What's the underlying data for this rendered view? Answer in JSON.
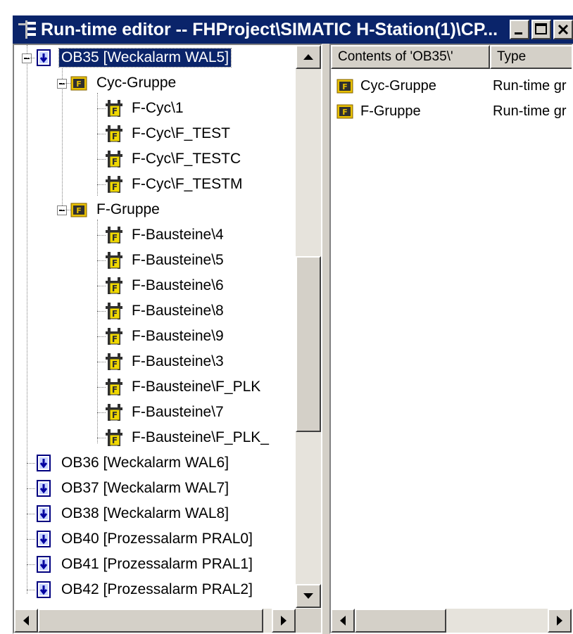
{
  "window": {
    "title": "Run-time editor -- FHProject\\SIMATIC H-Station(1)\\CP...",
    "controls": [
      "minimize",
      "maximize",
      "close"
    ]
  },
  "tree": {
    "nodes": [
      {
        "label": "OB35  [Weckalarm WAL5]",
        "type": "ob",
        "selected": true
      },
      {
        "label": "Cyc-Gruppe",
        "type": "group"
      },
      {
        "label": "F-Cyc\\1",
        "type": "block"
      },
      {
        "label": "F-Cyc\\F_TEST",
        "type": "block"
      },
      {
        "label": "F-Cyc\\F_TESTC",
        "type": "block"
      },
      {
        "label": "F-Cyc\\F_TESTM",
        "type": "block"
      },
      {
        "label": "F-Gruppe",
        "type": "group"
      },
      {
        "label": "F-Bausteine\\4",
        "type": "block"
      },
      {
        "label": "F-Bausteine\\5",
        "type": "block"
      },
      {
        "label": "F-Bausteine\\6",
        "type": "block"
      },
      {
        "label": "F-Bausteine\\8",
        "type": "block"
      },
      {
        "label": "F-Bausteine\\9",
        "type": "block"
      },
      {
        "label": "F-Bausteine\\3",
        "type": "block"
      },
      {
        "label": "F-Bausteine\\F_PLK",
        "type": "block"
      },
      {
        "label": "F-Bausteine\\7",
        "type": "block"
      },
      {
        "label": "F-Bausteine\\F_PLK_",
        "type": "block"
      },
      {
        "label": "OB36  [Weckalarm WAL6]",
        "type": "ob"
      },
      {
        "label": "OB37  [Weckalarm WAL7]",
        "type": "ob"
      },
      {
        "label": "OB38  [Weckalarm WAL8]",
        "type": "ob"
      },
      {
        "label": "OB40  [Prozessalarm PRAL0]",
        "type": "ob"
      },
      {
        "label": "OB41  [Prozessalarm PRAL1]",
        "type": "ob"
      },
      {
        "label": "OB42  [Prozessalarm PRAL2]",
        "type": "ob"
      }
    ]
  },
  "list": {
    "columns": [
      "Contents of 'OB35\\'",
      "Type"
    ],
    "rows": [
      {
        "name": "Cyc-Gruppe",
        "type": "Run-time gr"
      },
      {
        "name": "F-Gruppe",
        "type": "Run-time gr"
      }
    ]
  },
  "colors": {
    "titlebar": "#0a246a",
    "selection": "#0a246a",
    "chrome": "#d4d0c8",
    "group_icon": "#e8c000",
    "block_icon": "#f0d800",
    "ob_icon": "#0000a0"
  }
}
